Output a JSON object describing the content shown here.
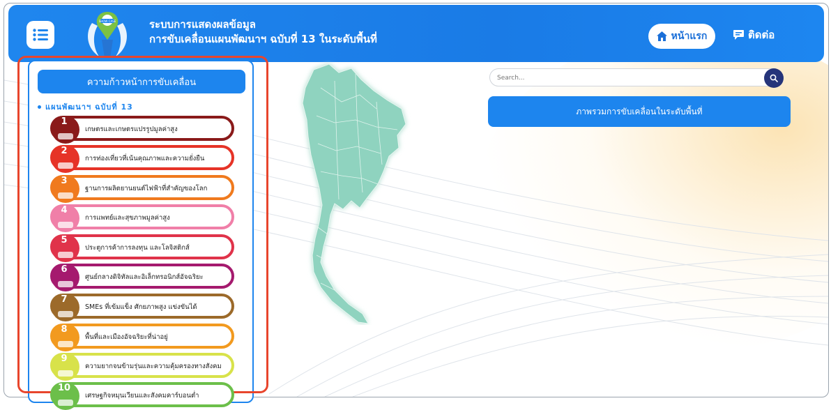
{
  "header": {
    "title_line1": "ระบบการแสดงผลข้อมูล",
    "title_line2": "การขับเคลื่อนแผนพัฒนาฯ ฉบับที่ 13 ในระดับพื้นที่",
    "logo_text": "SHOW CASE",
    "home_label": "หน้าแรก",
    "contact_label": "ติดต่อ",
    "menu_icon": "hamburger-icon",
    "home_icon": "home-icon",
    "contact_icon": "chat-icon"
  },
  "sidebar": {
    "title": "ความก้าวหน้าการขับเคลื่อน",
    "plan_label": "แผนพัฒนาฯ ฉบับที่ 13",
    "items": [
      {
        "number": "1",
        "label": "เกษตรและเกษตรแปรรูปมูลค่าสูง",
        "color": "#8a1a1a"
      },
      {
        "number": "2",
        "label": "การท่องเที่ยวที่เน้นคุณภาพและความยั่งยืน",
        "color": "#e63327"
      },
      {
        "number": "3",
        "label": "ฐานการผลิตยานยนต์ไฟฟ้าที่สำคัญของโลก",
        "color": "#f07a1e"
      },
      {
        "number": "4",
        "label": "การแพทย์และสุขภาพมูลค่าสูง",
        "color": "#f07fa8"
      },
      {
        "number": "5",
        "label": "ประตูการค้าการลงทุน และโลจิสติกส์",
        "color": "#e0334a"
      },
      {
        "number": "6",
        "label": "ศูนย์กลางดิจิทัลและอิเล็กทรอนิกส์อัจฉริยะ",
        "color": "#a51a6e"
      },
      {
        "number": "7",
        "label": "SMEs ที่เข้มแข็ง ศักยภาพสูง แข่งขันได้",
        "color": "#9c6a2a"
      },
      {
        "number": "8",
        "label": "พื้นที่และเมืองอัจฉริยะที่น่าอยู่",
        "color": "#f29a1f"
      },
      {
        "number": "9",
        "label": "ความยากจนข้ามรุ่นและความคุ้มครองทางสังคม",
        "color": "#d8e24a"
      },
      {
        "number": "10",
        "label": "เศรษฐกิจหมุนเวียนและสังคมคาร์บอนต่ำ",
        "color": "#6cbf4a"
      }
    ]
  },
  "main": {
    "search_placeholder": "Search...",
    "search_icon": "search-icon",
    "overview_label": "ภาพรวมการขับเคลื่อนในระดับพื้นที่"
  }
}
